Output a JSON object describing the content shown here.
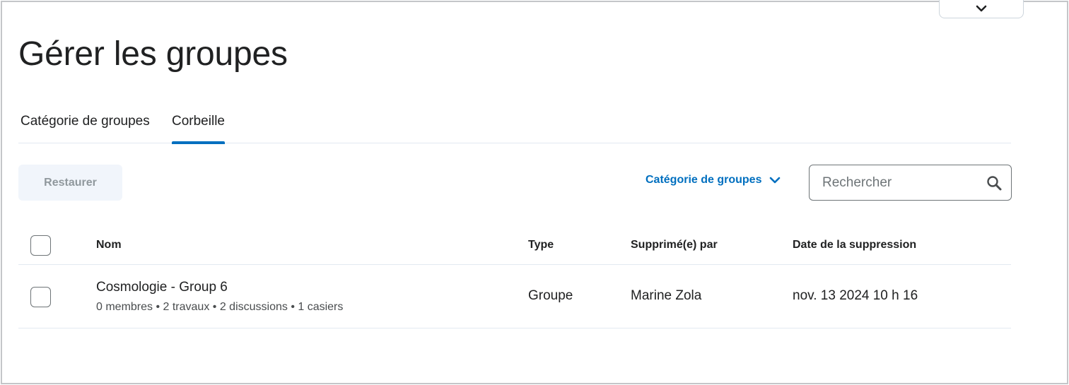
{
  "page": {
    "title": "Gérer les groupes"
  },
  "tabs": [
    {
      "label": "Catégorie de groupes",
      "active": false
    },
    {
      "label": "Corbeille",
      "active": true
    }
  ],
  "toolbar": {
    "restore_label": "Restaurer",
    "restore_disabled": true,
    "category_filter_label": "Catégorie de groupes",
    "search_placeholder": "Rechercher",
    "search_value": ""
  },
  "table": {
    "columns": [
      "Nom",
      "Type",
      "Supprimé(e) par",
      "Date de la suppression"
    ],
    "rows": [
      {
        "name": "Cosmologie - Group 6",
        "meta": "0 membres • 2 travaux • 2 discussions • 1 casiers",
        "type": "Groupe",
        "deleted_by": "Marine Zola",
        "deleted_date": "nov. 13 2024 10 h 16",
        "checked": false
      }
    ]
  },
  "icons": {
    "top_dropdown": "chevron-down-icon",
    "category_filter": "chevron-down-icon",
    "search": "search-icon"
  },
  "colors": {
    "accent": "#006fbf",
    "text": "#202122",
    "muted": "#494c4e",
    "disabled_bg": "#f1f5fb",
    "disabled_text": "#90989d",
    "border": "#e3e9f1"
  }
}
